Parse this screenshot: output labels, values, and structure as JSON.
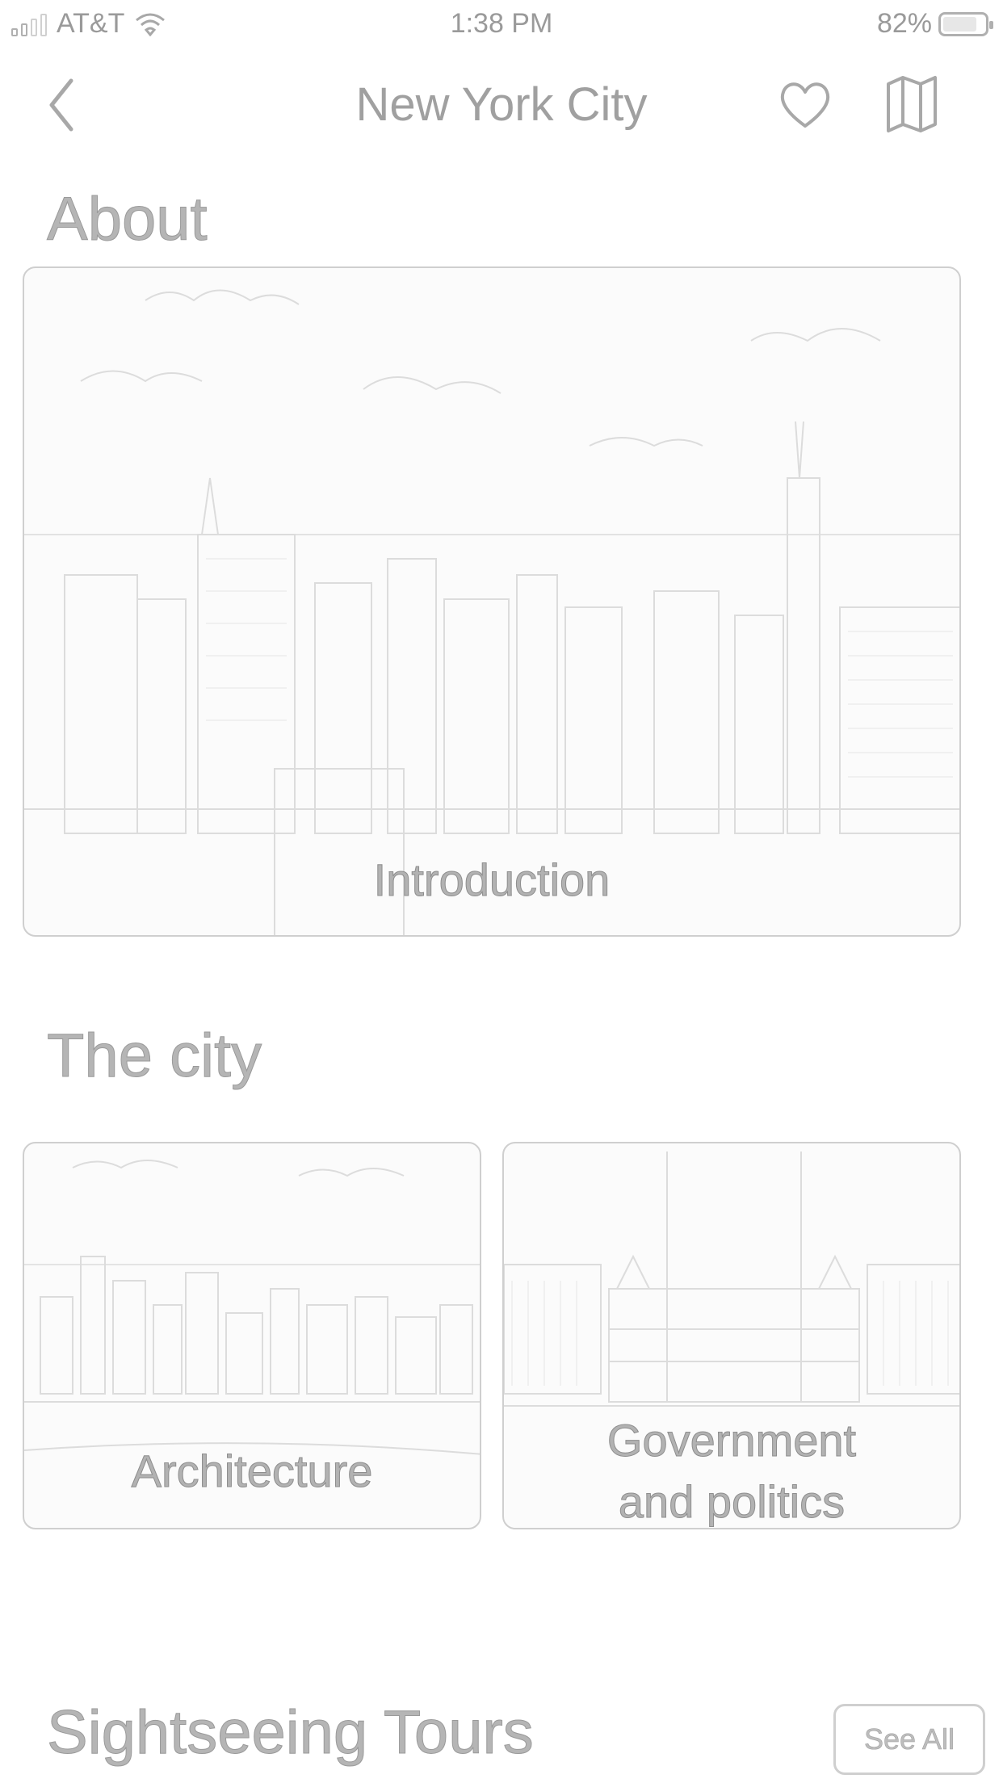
{
  "status_bar": {
    "carrier": "AT&T",
    "time": "1:38 PM",
    "battery": "82%",
    "battery_level": 0.82
  },
  "nav": {
    "title": "New York City",
    "back_icon": "chevron-left-icon",
    "favorite_icon": "heart-icon",
    "map_icon": "map-icon"
  },
  "sections": {
    "about": {
      "title": "About",
      "cards": [
        {
          "label": "Introduction"
        }
      ]
    },
    "city": {
      "title": "The city",
      "cards": [
        {
          "label": "Architecture"
        },
        {
          "label_line1": "Government",
          "label_line2": "and politics"
        }
      ]
    },
    "tours": {
      "title": "Sightseeing Tours",
      "see_all_label": "See All"
    }
  },
  "colors": {
    "text": "#9a9a9a",
    "border": "#cfcfcf"
  }
}
